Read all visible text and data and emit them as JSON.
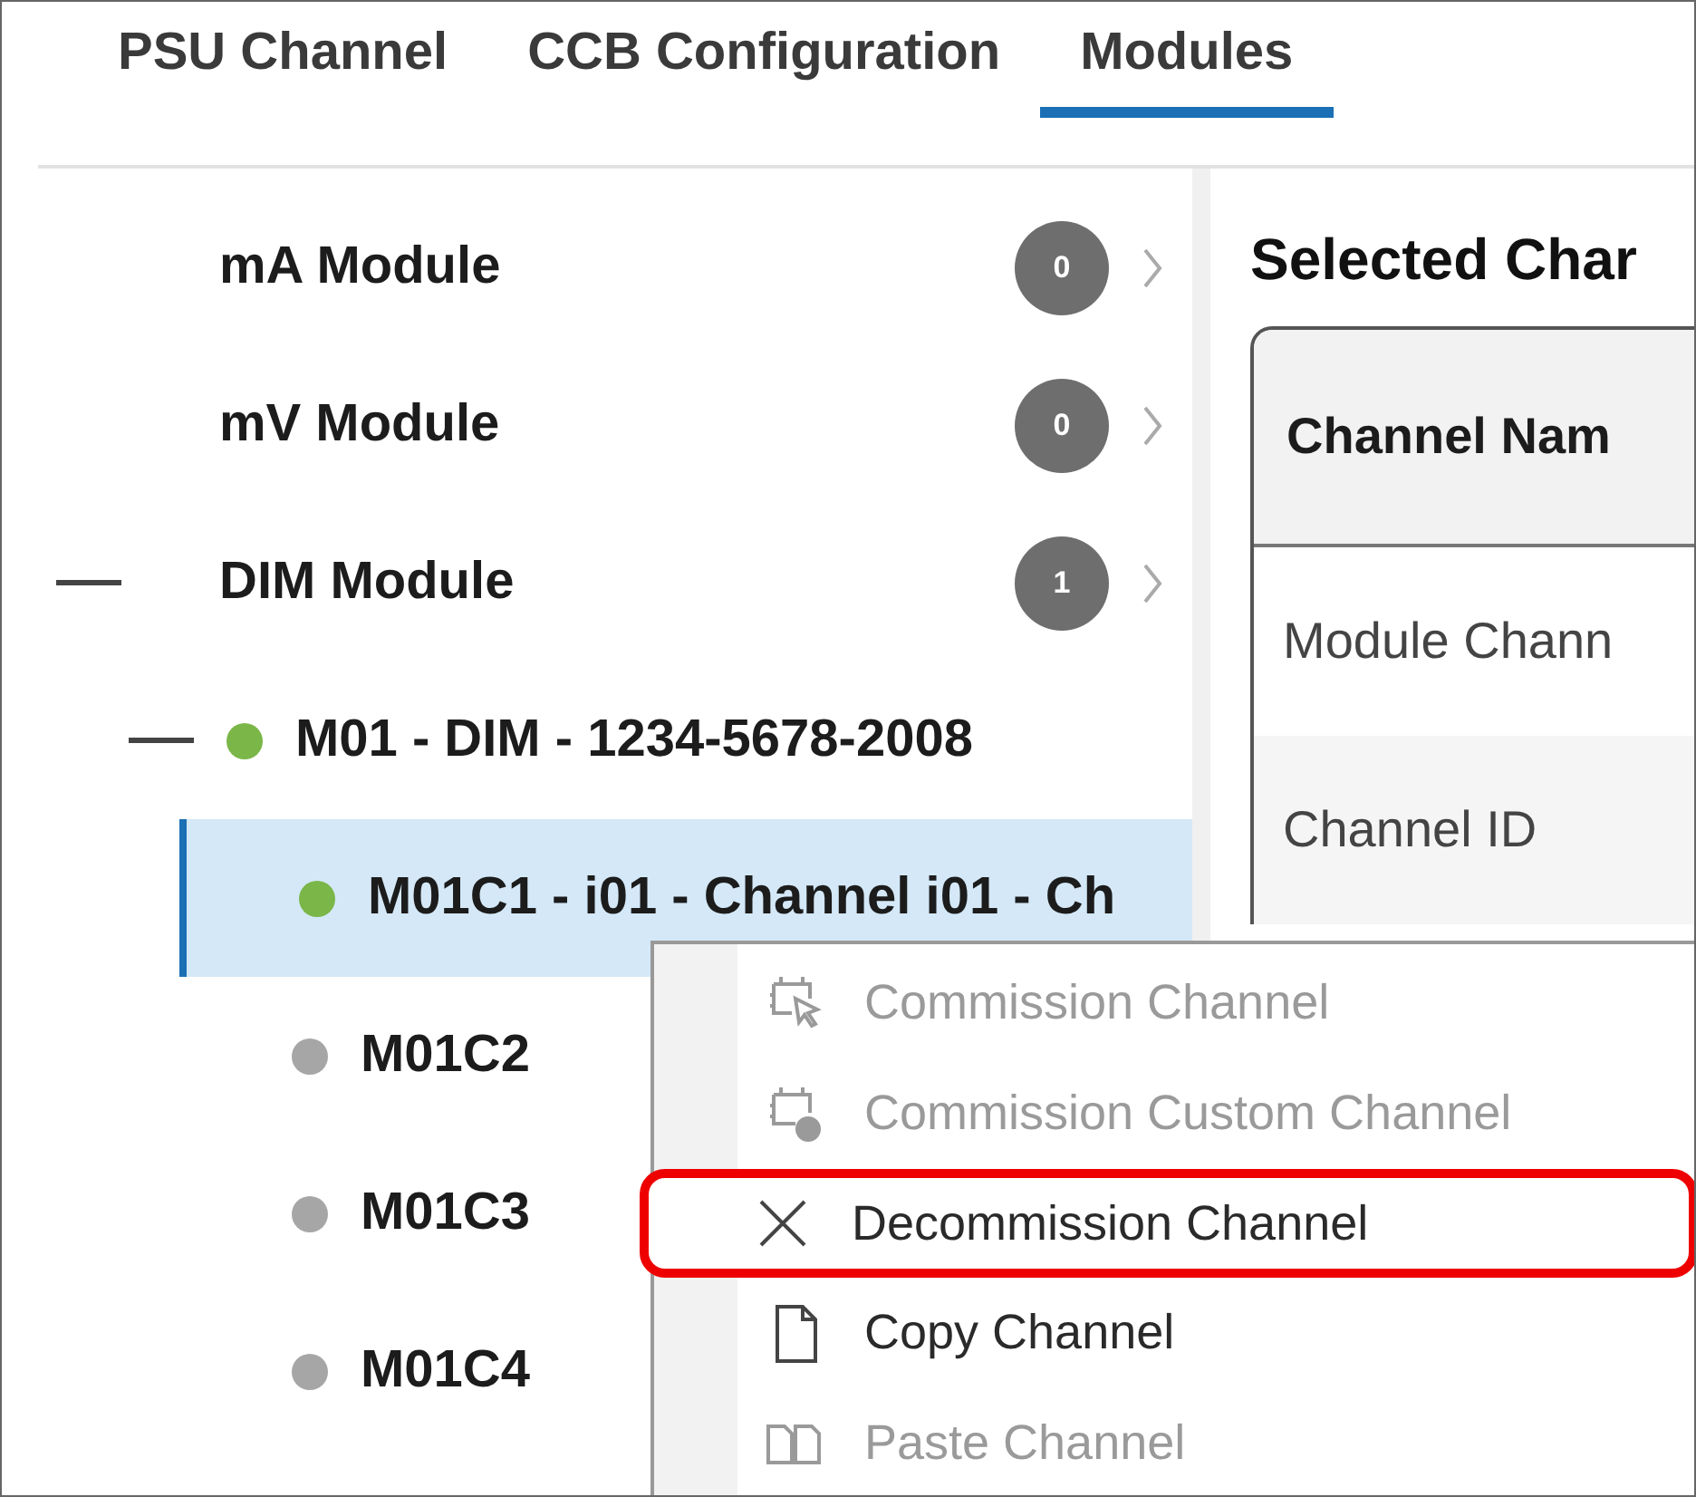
{
  "tabs": [
    {
      "label": "PSU Channel",
      "selected": false
    },
    {
      "label": "CCB Configuration",
      "selected": false
    },
    {
      "label": "Modules",
      "selected": true
    }
  ],
  "tree": [
    {
      "label": "mA Module",
      "count": "0",
      "expanded": false
    },
    {
      "label": "mV Module",
      "count": "0",
      "expanded": false
    },
    {
      "label": "DIM Module",
      "count": "1",
      "expanded": true,
      "children": [
        {
          "label": "M01 - DIM - 1234-5678-2008",
          "color": "#7ab648",
          "expanded": true,
          "children": [
            {
              "label": "M01C1 - i01 - Channel i01 - Ch",
              "color": "#7ab648",
              "selected": true
            },
            {
              "label": "M01C2",
              "color": "#a6a6a6",
              "selected": false
            },
            {
              "label": "M01C3",
              "color": "#a6a6a6",
              "selected": false
            },
            {
              "label": "M01C4",
              "color": "#a6a6a6",
              "selected": false
            }
          ]
        }
      ]
    }
  ],
  "details": {
    "heading": "Selected Char",
    "header": "Channel Nam",
    "rows": [
      "Module Chann",
      "Channel ID"
    ]
  },
  "context_menu": [
    {
      "kind": "commission",
      "label": "Commission Channel",
      "disabled": true,
      "highlighted": false
    },
    {
      "kind": "commission-custom",
      "label": "Commission Custom Channel",
      "disabled": true,
      "highlighted": false
    },
    {
      "kind": "decommission",
      "label": "Decommission Channel",
      "disabled": false,
      "highlighted": true
    },
    {
      "kind": "copy",
      "label": "Copy Channel",
      "disabled": false,
      "highlighted": false
    },
    {
      "kind": "paste",
      "label": "Paste Channel",
      "disabled": true,
      "highlighted": false
    }
  ]
}
